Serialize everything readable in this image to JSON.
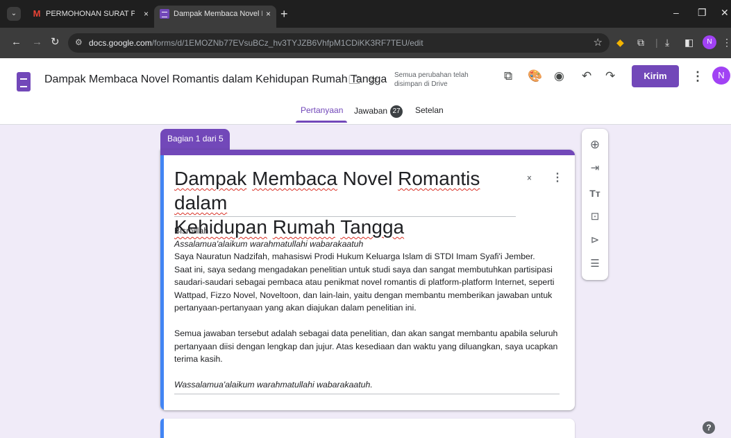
{
  "browser": {
    "tabs": [
      {
        "title": "PERMOHONAN SURAT PENELIT",
        "favicon": "gmail-icon"
      },
      {
        "title": "Dampak Membaca Novel Roma",
        "favicon": "forms-icon"
      }
    ],
    "tab_close": "×",
    "new_tab": "+",
    "url_host": "docs.google.com",
    "url_path": "/forms/d/1EMOZNb77EVsuBCz_hv3TYJZB6VhfpM1CDiKK3RF7TEU/edit",
    "profile_initial": "N"
  },
  "forms": {
    "doc_title": "Dampak Membaca Novel Romantis dalam Kehidupan Rumah Tangga",
    "save_status": "Semua perubahan telah disimpan di Drive",
    "send_label": "Kirim",
    "avatar_initial": "N",
    "accent_color": "#7248b9",
    "tabs": {
      "questions": "Pertanyaan",
      "responses": "Jawaban",
      "responses_count": "27",
      "settings": "Setelan"
    }
  },
  "section": {
    "label": "Bagian 1 dari 5",
    "title_line1": [
      "Dampak",
      " ",
      "Membaca",
      " Novel ",
      "Romantis",
      " ",
      "dalam"
    ],
    "title_line2": [
      "Kehidupan",
      " ",
      "Rumah",
      " ",
      "Tangga"
    ],
    "description": {
      "line1": "Bismillah",
      "line2": "Assalamua'alaikum warahmatullahi wabarakaatuh",
      "para1": "Saya Nauratun Nadzifah, mahasiswi Prodi Hukum Keluarga Islam di STDI Imam Syafi'i Jember.",
      "para2": "Saat ini, saya sedang mengadakan penelitian untuk studi saya dan sangat membutuhkan partisipasi saudari-saudari sebagai pembaca atau penikmat novel romantis di platform-platform Internet, seperti Wattpad, Fizzo Novel, Noveltoon, dan lain-lain, yaitu dengan membantu memberikan jawaban untuk pertanyaan-pertanyaan yang akan diajukan dalam penelitian ini.",
      "para3": "Semua jawaban tersebut adalah sebagai data penelitian, dan akan sangat membantu apabila seluruh pertanyaan diisi dengan lengkap dan jujur. Atas kesediaan dan waktu yang diluangkan, saya ucapkan terima kasih.",
      "closing": "Wassalamua'alaikum warahmatullahi wabarakaatuh."
    }
  },
  "help_label": "?"
}
